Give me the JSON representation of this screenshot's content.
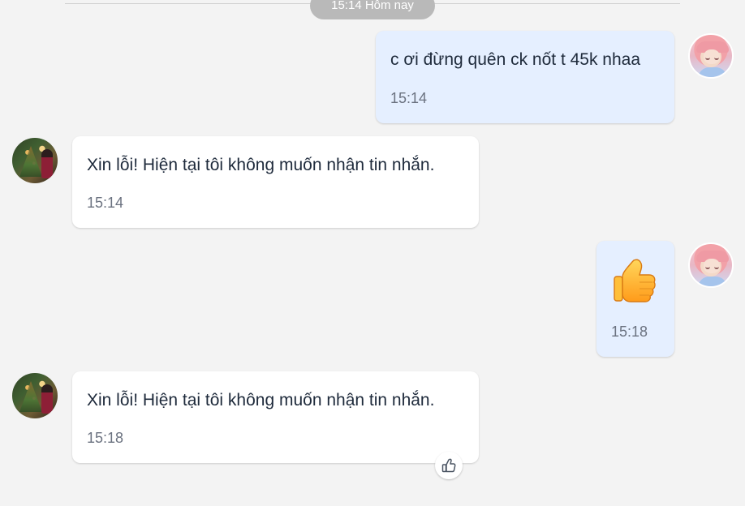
{
  "conversation": {
    "date_divider": "15:14 Hôm nay",
    "messages": [
      {
        "text": "c ơi đừng quên ck nốt t 45k nhaa",
        "time": "15:14"
      },
      {
        "text": "Xin lỗi! Hiện tại tôi không muốn nhận tin nhắn.",
        "time": "15:14"
      },
      {
        "emoji": "thumbs-up",
        "time": "15:18"
      },
      {
        "text": "Xin lỗi! Hiện tại tôi không muốn nhận tin nhắn.",
        "time": "15:18"
      }
    ]
  },
  "icons": {
    "sent_avatar": "anime-avatar-icon",
    "received_avatar": "user-avatar-icon",
    "reaction": "thumbs-up-outline-icon"
  },
  "colors": {
    "sent_bubble": "#e5efff",
    "received_bubble": "#ffffff",
    "background": "#f3f3f3"
  }
}
